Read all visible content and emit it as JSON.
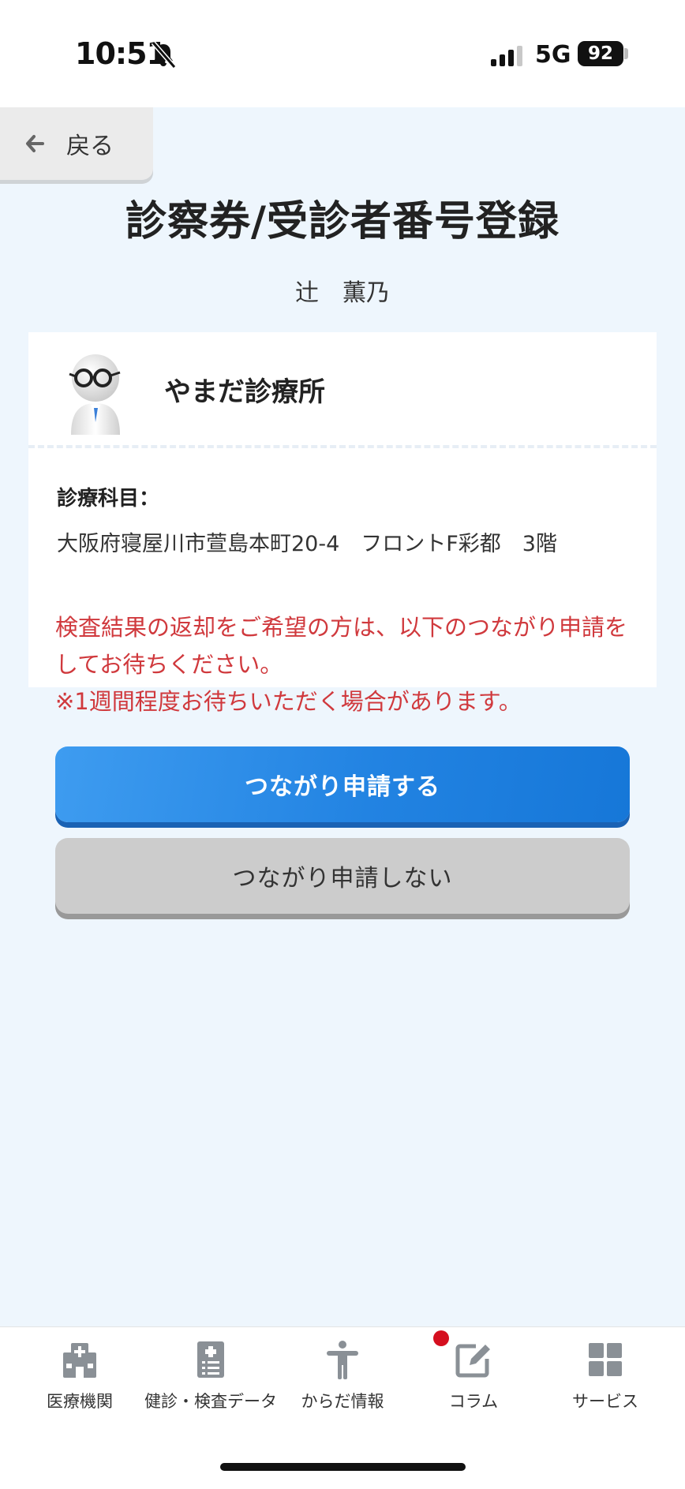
{
  "status_bar": {
    "time": "10:51",
    "network": "5G",
    "battery": "92",
    "icons": [
      "bell-muted-icon",
      "signal-icon"
    ]
  },
  "header": {
    "back_label": "戻る",
    "title": "診察券/受診者番号登録",
    "patient_name": "辻　薫乃"
  },
  "clinic": {
    "name": "やまだ診療所",
    "department_label": "診療科目：",
    "address": "大阪府寝屋川市萱島本町20-4　フロントF彩都　3階"
  },
  "notice": {
    "line1": "検査結果の返却をご希望の方は、以下のつながり申請をしてお待ちください。",
    "line2": "※1週間程度お待ちいただく場合があります。"
  },
  "buttons": {
    "connect": "つながり申請する",
    "decline": "つながり申請しない"
  },
  "colors": {
    "primary_blue": "#2283e2",
    "notice_red": "#d0393d",
    "background": "#eef6fd",
    "tab_icon_gray": "#8a9096",
    "notification_red": "#d50f1f"
  },
  "tabs": [
    {
      "label": "医療機関",
      "icon": "hospital-icon"
    },
    {
      "label": "健診・検査データ",
      "icon": "clipboard-icon"
    },
    {
      "label": "からだ情報",
      "icon": "person-icon"
    },
    {
      "label": "コラム",
      "icon": "edit-icon",
      "has_notification": true
    },
    {
      "label": "サービス",
      "icon": "grid-icon"
    }
  ]
}
